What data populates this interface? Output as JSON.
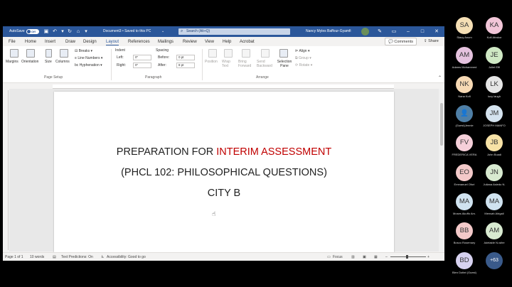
{
  "titlebar": {
    "autosave_label": "AutoSave",
    "autosave_state": "Off",
    "doc_title": "Document3 • Saved to this PC",
    "search_placeholder": "Search (Alt+Q)",
    "user_name": "Nancy Myles Baffour-Gyamfi",
    "accent": "#2b579a"
  },
  "tabs": [
    "File",
    "Home",
    "Insert",
    "Draw",
    "Design",
    "Layout",
    "References",
    "Mailings",
    "Review",
    "View",
    "Help",
    "Acrobat"
  ],
  "active_tab": "Layout",
  "tab_actions": {
    "comments": "Comments",
    "share": "Share"
  },
  "ribbon": {
    "page_setup": {
      "margins": "Margins",
      "orientation": "Orientation",
      "size": "Size",
      "columns": "Columns",
      "breaks": "Breaks",
      "line_numbers": "Line Numbers",
      "hyphenation": "Hyphenation",
      "label": "Page Setup"
    },
    "paragraph": {
      "indent": "Indent",
      "left": "Left:",
      "left_val": "0\"",
      "right": "Right:",
      "right_val": "0\"",
      "spacing": "Spacing",
      "before": "Before:",
      "before_val": "0 pt",
      "after": "After:",
      "after_val": "8 pt",
      "label": "Paragraph"
    },
    "arrange": {
      "position": "Position",
      "wrap_text": "Wrap Text",
      "bring_forward": "Bring Forward",
      "send_backward": "Send Backward",
      "selection_pane": "Selection Pane",
      "align": "Align",
      "group": "Group",
      "rotate": "Rotate",
      "label": "Arrange"
    }
  },
  "document": {
    "line1_part1": "PREPARATION FOR ",
    "line1_part2": "INTERIM ASSESSMENT",
    "line2": "(PHCL 102: PHILOSOPHICAL QUESTIONS)",
    "line3": "CITY B",
    "highlight_color": "#c00000"
  },
  "statusbar": {
    "page": "Page 1 of 1",
    "words": "10 words",
    "text_predictions": "Text Predictions: On",
    "accessibility": "Accessibility: Good to go",
    "focus": "Focus"
  },
  "participants": [
    {
      "initials": "SA",
      "name": "Stacy Anum",
      "color": "#f5dfb5"
    },
    {
      "initials": "KA",
      "name": "Kofi Afrakor",
      "color": "#f2c6d8"
    },
    {
      "initials": "AM",
      "name": "Adams Mohammed",
      "color": "#e5c2de"
    },
    {
      "initials": "JE",
      "name": "Juliet Effi",
      "color": "#cfe8c4"
    },
    {
      "initials": "NK",
      "name": "Nana Kofi",
      "color": "#f7d9b4"
    },
    {
      "initials": "LK",
      "name": "lucy laugh",
      "color": "#e6e6e6"
    },
    {
      "initials": "",
      "name": "(Guest)Jennie",
      "color": "#4f7fa6"
    },
    {
      "initials": "JM",
      "name": "JOSEPH MANFO",
      "color": "#d5e3ef"
    },
    {
      "initials": "FV",
      "name": "FREDERICA VERA",
      "color": "#f5cfd9"
    },
    {
      "initials": "JB",
      "name": "John Boadi",
      "color": "#f7e2a6"
    },
    {
      "initials": "EO",
      "name": "Emmanuel Ofori",
      "color": "#f3c9c9"
    },
    {
      "initials": "JN",
      "name": "Juliana Asiedu N.",
      "color": "#d8ead0"
    },
    {
      "initials": "MA",
      "name": "Moses Akuffo Am.",
      "color": "#d0e3f0"
    },
    {
      "initials": "MA",
      "name": "Mensah Abigail",
      "color": "#d0e3f0"
    },
    {
      "initials": "BB",
      "name": "Bosco Rosemary",
      "color": "#f3c9c9"
    },
    {
      "initials": "AM",
      "name": "Adelaide N-wiire",
      "color": "#d8ead0"
    },
    {
      "initials": "BD",
      "name": "Blen Dottei (Guest)",
      "color": "#d7d2f0"
    }
  ],
  "more_participants": "+63"
}
